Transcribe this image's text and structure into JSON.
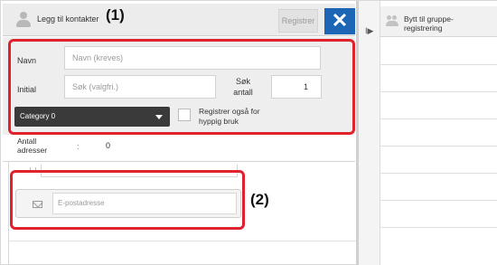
{
  "header": {
    "title": "Legg til kontakter",
    "register_label": "Registrer",
    "close_symbol": "✕"
  },
  "callouts": {
    "one": "(1)",
    "two": "(2)"
  },
  "form": {
    "name_label": "Navn",
    "name_placeholder": "Navn (kreves)",
    "initial_label": "Initial",
    "initial_placeholder": "Søk (valgfri.)",
    "search_count_label": "Søk antall",
    "search_count_value": "1",
    "category_value": "Category 0",
    "frequent_use_label": "Registrer også for hyppig bruk",
    "frequent_use_checked": false
  },
  "count": {
    "label": "Antall adresser",
    "separator": ":",
    "value": "0"
  },
  "email": {
    "placeholder": "E-postadresse"
  },
  "right_panel": {
    "expand_symbol": "I▶",
    "group_register_label": "Bytt til gruppe-registrering"
  },
  "colors": {
    "close_button": "#1d66b5",
    "highlight": "#e0212e",
    "category_select": "#3a3a3a"
  },
  "icons": [
    "user-icon",
    "mail-icon",
    "group-icon",
    "expand-icon"
  ]
}
